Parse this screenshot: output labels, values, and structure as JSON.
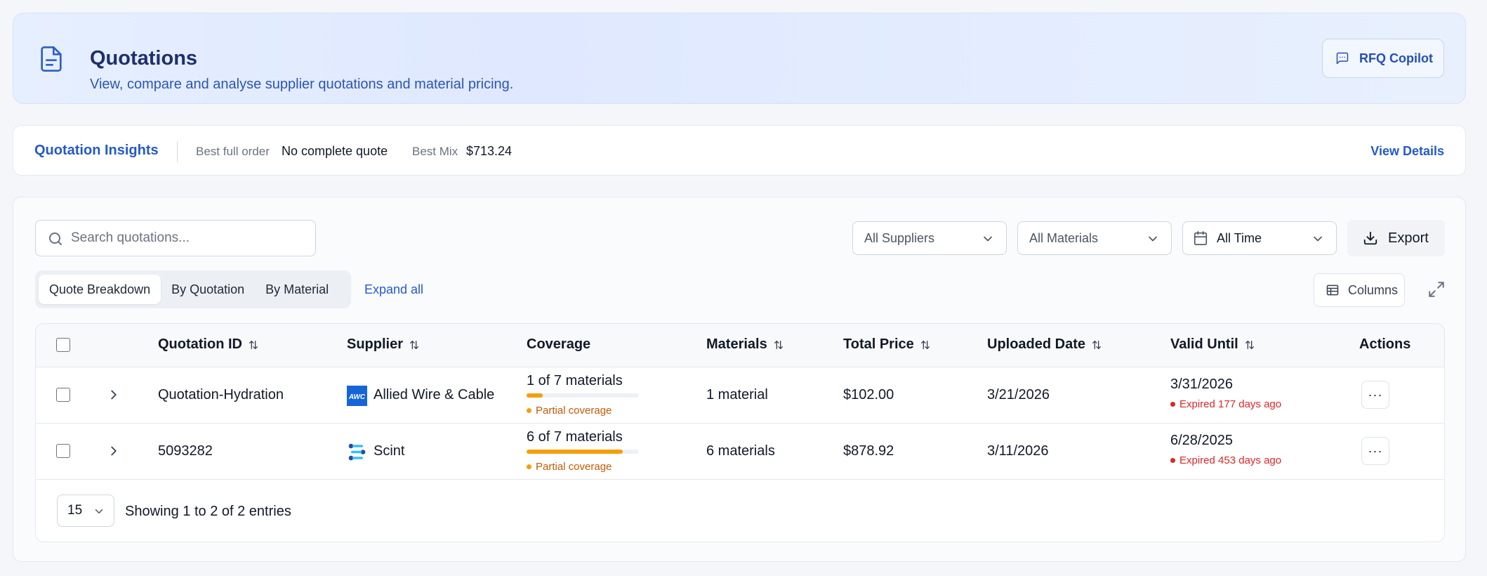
{
  "header": {
    "title": "Quotations",
    "subtitle": "View, compare and analyse supplier quotations and material pricing.",
    "copilot_label": "RFQ Copilot"
  },
  "insights": {
    "title": "Quotation Insights",
    "best_full_order_label": "Best full order",
    "best_full_order_value": "No complete quote",
    "best_mix_label": "Best Mix",
    "best_mix_value": "$713.24",
    "view_details": "View Details"
  },
  "toolbar": {
    "search_placeholder": "Search quotations...",
    "supplier_filter": "All Suppliers",
    "material_filter": "All Materials",
    "time_filter": "All Time",
    "export_label": "Export",
    "tabs": [
      {
        "label": "Quote Breakdown",
        "active": true
      },
      {
        "label": "By Quotation",
        "active": false
      },
      {
        "label": "By Material",
        "active": false
      }
    ],
    "expand_all": "Expand all",
    "columns_label": "Columns"
  },
  "table": {
    "headers": {
      "quotation_id": "Quotation ID",
      "supplier": "Supplier",
      "coverage": "Coverage",
      "materials": "Materials",
      "total_price": "Total Price",
      "uploaded_date": "Uploaded Date",
      "valid_until": "Valid Until",
      "actions": "Actions"
    },
    "rows": [
      {
        "quotation_id": "Quotation-Hydration",
        "supplier": "Allied Wire & Cable",
        "supplier_logo_text": "AWC",
        "coverage_text": "1 of 7 materials",
        "coverage_fraction": 0.1429,
        "coverage_note": "Partial coverage",
        "materials": "1 material",
        "total_price": "$102.00",
        "uploaded_date": "3/21/2026",
        "valid_until": "3/31/2026",
        "valid_note": "Expired 177 days ago",
        "actions": "···"
      },
      {
        "quotation_id": "5093282",
        "supplier": "Scint",
        "coverage_text": "6 of 7 materials",
        "coverage_fraction": 0.857,
        "coverage_note": "Partial coverage",
        "materials": "6 materials",
        "total_price": "$878.92",
        "uploaded_date": "3/11/2026",
        "valid_until": "6/28/2025",
        "valid_note": "Expired 453 days ago",
        "actions": "···"
      }
    ]
  },
  "pagination": {
    "page_size": "15",
    "showing": "Showing 1 to 2 of 2 entries"
  },
  "colors": {
    "accent": "#2459c8",
    "coverage": "#f59e0b",
    "expired": "#dc2626"
  }
}
